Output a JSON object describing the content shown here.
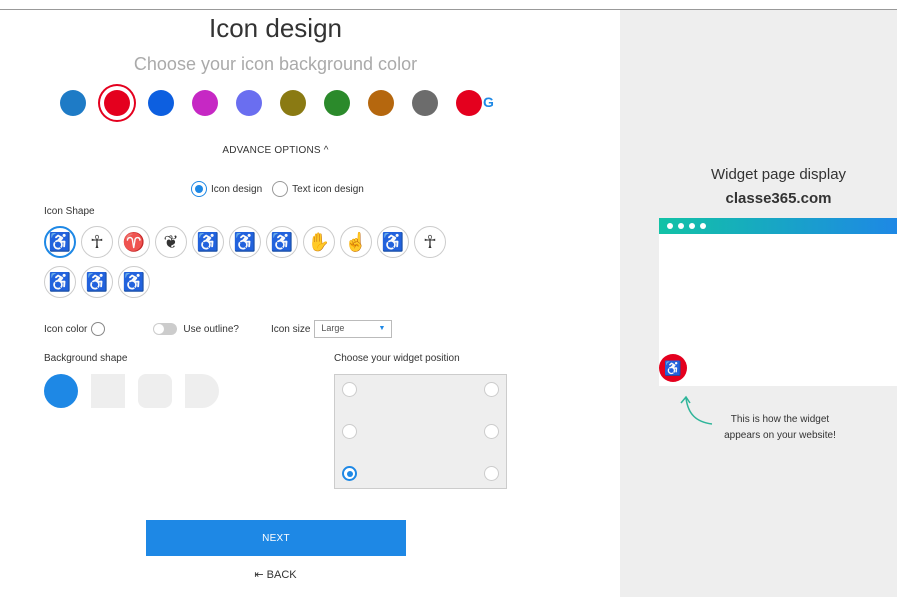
{
  "left": {
    "title": "Icon design",
    "subtitle": "Choose your icon background color",
    "colors": [
      {
        "hex": "#1e7bc6",
        "selected": false
      },
      {
        "hex": "#e4001e",
        "selected": true
      },
      {
        "hex": "#0d5fe0",
        "selected": false
      },
      {
        "hex": "#c628c4",
        "selected": false
      },
      {
        "hex": "#6a6ef0",
        "selected": false
      },
      {
        "hex": "#8a7a13",
        "selected": false
      },
      {
        "hex": "#2b8a2b",
        "selected": false
      },
      {
        "hex": "#b5670e",
        "selected": false
      },
      {
        "hex": "#6c6c6c",
        "selected": false
      },
      {
        "hex": "#e4001e",
        "selected": false
      }
    ],
    "google_mark": "G",
    "advance_options": "ADVANCE OPTIONS",
    "advance_chevron": "^",
    "design_mode": {
      "options": [
        {
          "label": "Icon design",
          "selected": true
        },
        {
          "label": "Text icon design",
          "selected": false
        }
      ]
    },
    "icon_shape_label": "Icon Shape",
    "icon_shapes": [
      {
        "icon": "wheelchair-dynamic-icon",
        "glyph": "♿",
        "selected": true
      },
      {
        "icon": "person-arms-down-icon",
        "glyph": "☥",
        "selected": false
      },
      {
        "icon": "person-arms-up-icon",
        "glyph": "♈",
        "selected": false
      },
      {
        "icon": "person-heart-icon",
        "glyph": "❦",
        "selected": false
      },
      {
        "icon": "wheelchair-outline-icon",
        "glyph": "♿",
        "selected": false
      },
      {
        "icon": "wheelchair-icon",
        "glyph": "♿",
        "selected": false
      },
      {
        "icon": "wheelchair-motion-icon",
        "glyph": "♿",
        "selected": false
      },
      {
        "icon": "hand-open-icon",
        "glyph": "✋",
        "selected": false
      },
      {
        "icon": "hand-pointer-icon",
        "glyph": "☝",
        "selected": false
      },
      {
        "icon": "wheelchair-light-icon",
        "glyph": "♿",
        "selected": false
      },
      {
        "icon": "person-universal-icon",
        "glyph": "☥",
        "selected": false
      },
      {
        "icon": "wheelchair-bold-icon",
        "glyph": "♿",
        "selected": false
      },
      {
        "icon": "wheelchair-classic-icon",
        "glyph": "♿",
        "selected": false
      },
      {
        "icon": "wheelchair-circle-icon",
        "glyph": "♿",
        "selected": false
      }
    ],
    "icon_color_label": "Icon color",
    "use_outline_label": "Use outline?",
    "icon_size_label": "Icon size",
    "icon_size_value": "Large",
    "select_caret": "▼",
    "background_shape_label": "Background shape",
    "background_shapes": [
      "circle",
      "square",
      "rounded-square",
      "half-round"
    ],
    "widget_position_label": "Choose your widget position",
    "positions": [
      {
        "name": "top-left",
        "selected": false
      },
      {
        "name": "top-right",
        "selected": false
      },
      {
        "name": "middle-left",
        "selected": false
      },
      {
        "name": "middle-right",
        "selected": false
      },
      {
        "name": "bottom-left",
        "selected": true
      },
      {
        "name": "bottom-right",
        "selected": false
      }
    ],
    "next_label": "NEXT",
    "back_icon": "⇤",
    "back_label": "BACK"
  },
  "right": {
    "title": "Widget page display",
    "domain": "classe365.com",
    "widget_glyph": "♿",
    "hint_line1": "This is how the widget",
    "hint_line2": "appears on your website!"
  }
}
